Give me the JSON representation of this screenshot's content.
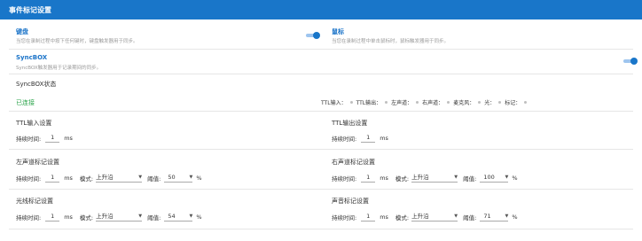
{
  "header": {
    "title": "事件标记设置"
  },
  "keyboard": {
    "title": "键盘",
    "desc": "当您在录制过程中按下任何键时，键盘触发器用于同步。",
    "enabled": true
  },
  "mouse": {
    "title": "鼠标",
    "desc": "当您在录制过程中单击鼠标时，鼠标触发器用于同步。",
    "enabled": true
  },
  "syncbox": {
    "title": "SyncBOX",
    "desc": "SyncBOX触发器用于记录期间的同步。",
    "enabled": true
  },
  "status": {
    "label": "SyncBOX状态",
    "value": "已连接",
    "indicators": [
      "TTL输入：",
      "TTL输出：",
      "左声道：",
      "右声道：",
      "麦克风：",
      "光：",
      "标记："
    ]
  },
  "ttl_in": {
    "title": "TTL输入设置",
    "duration_label": "持续时间:",
    "duration_value": "1",
    "unit": "ms"
  },
  "ttl_out": {
    "title": "TTL输出设置",
    "duration_label": "持续时间:",
    "duration_value": "1",
    "unit": "ms"
  },
  "left_ch": {
    "title": "左声道标记设置",
    "duration_label": "持续时间:",
    "duration_value": "1",
    "unit": "ms",
    "mode_label": "模式:",
    "mode_value": "上升沿",
    "threshold_label": "阈值:",
    "threshold_value": "50",
    "percent": "%"
  },
  "right_ch": {
    "title": "右声道标记设置",
    "duration_label": "持续时间:",
    "duration_value": "1",
    "unit": "ms",
    "mode_label": "模式:",
    "mode_value": "上升沿",
    "threshold_label": "阈值:",
    "threshold_value": "100",
    "percent": "%"
  },
  "light": {
    "title": "光线标记设置",
    "duration_label": "持续时间:",
    "duration_value": "1",
    "unit": "ms",
    "mode_label": "模式:",
    "mode_value": "上升沿",
    "threshold_label": "阈值:",
    "threshold_value": "54",
    "percent": "%"
  },
  "sound": {
    "title": "声音标记设置",
    "duration_label": "持续时间:",
    "duration_value": "1",
    "unit": "ms",
    "mode_label": "模式:",
    "mode_value": "上升沿",
    "threshold_label": "阈值:",
    "threshold_value": "71",
    "percent": "%"
  },
  "icons": {
    "dropdown": "▼"
  },
  "colors": {
    "accent": "#1976c9",
    "connected": "#2aa34a",
    "indicator_off": "#bfbfbf"
  }
}
